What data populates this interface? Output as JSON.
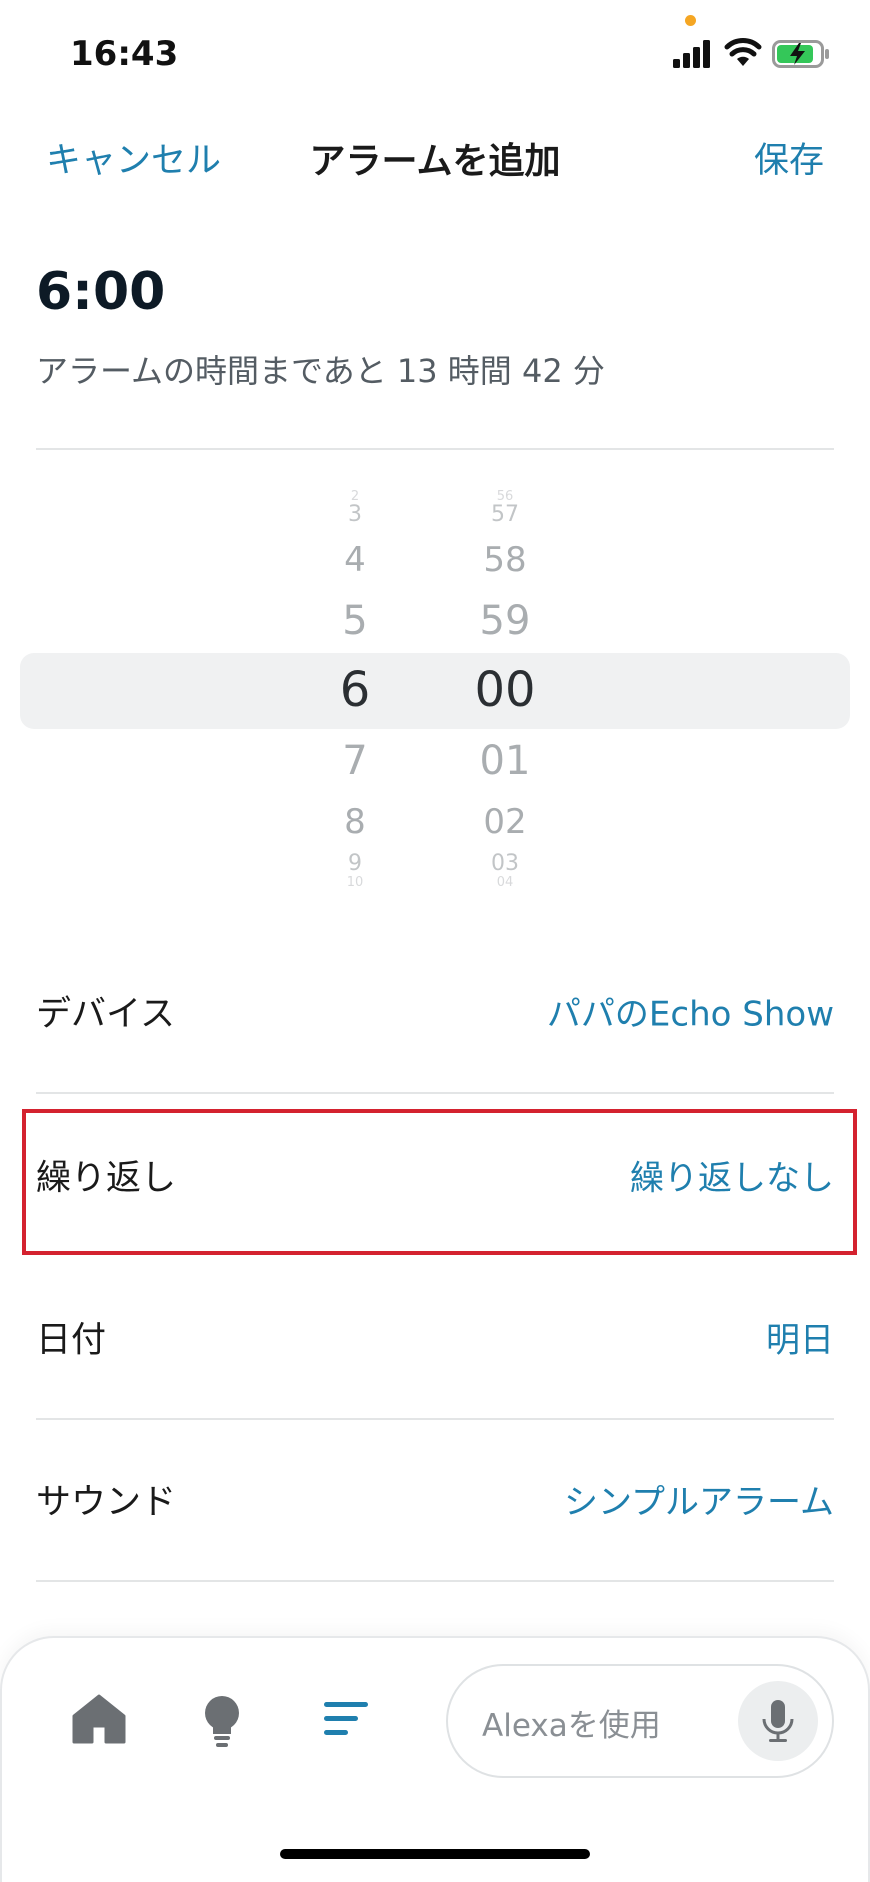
{
  "status_bar": {
    "time": "16:43"
  },
  "header": {
    "cancel_label": "キャンセル",
    "title": "アラームを追加",
    "save_label": "保存"
  },
  "alarm": {
    "time": "6:00",
    "remaining": "アラームの時間まであと 13 時間 42 分"
  },
  "picker": {
    "hours": [
      "2",
      "3",
      "4",
      "5",
      "6",
      "7",
      "8",
      "9",
      "10"
    ],
    "minutes": [
      "56",
      "57",
      "58",
      "59",
      "00",
      "01",
      "02",
      "03",
      "04"
    ],
    "selected_hour": "6",
    "selected_minute": "00"
  },
  "settings": [
    {
      "label": "デバイス",
      "value": "パパのEcho Show"
    },
    {
      "label": "繰り返し",
      "value": "繰り返しなし"
    },
    {
      "label": "日付",
      "value": "明日"
    },
    {
      "label": "サウンド",
      "value": "シンプルアラーム"
    }
  ],
  "bottom_nav": {
    "alexa_placeholder": "Alexaを使用"
  },
  "colors": {
    "accent": "#1f7fae",
    "highlight": "#d4222f",
    "orange_dot": "#f5a623",
    "battery_fill": "#34c759",
    "nav_active": "#1f7fae",
    "nav_inactive": "#6b6f73"
  }
}
